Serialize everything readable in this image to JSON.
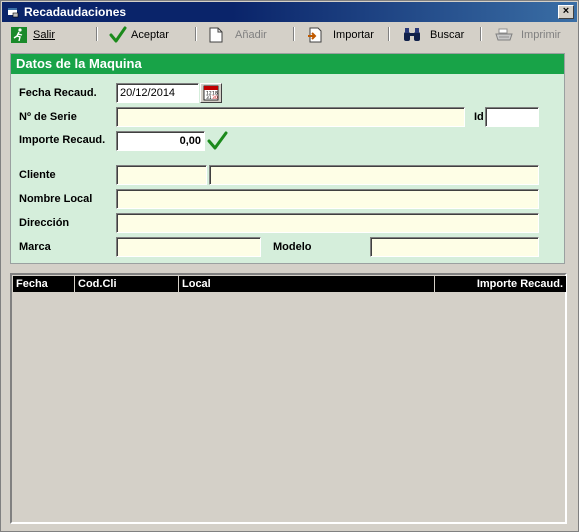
{
  "window": {
    "title": "Recadaudaciones",
    "close_label": "×"
  },
  "toolbar": {
    "salir": "Salir",
    "aceptar": "Aceptar",
    "anadir": "Añadir",
    "importar": "Importar",
    "buscar": "Buscar",
    "imprimir": "Imprimir"
  },
  "form": {
    "title": "Datos de la Maquina",
    "fecha_label": "Fecha Recaud.",
    "fecha_value": "20/12/2014",
    "serie_label": "Nº de Serie",
    "serie_value": "",
    "id_label": "Id",
    "id_value": "",
    "importe_label": "Importe Recaud.",
    "importe_value": "0,00",
    "cliente_label": "Cliente",
    "cliente_code": "",
    "cliente_name": "",
    "nombre_local_label": "Nombre Local",
    "nombre_local_value": "",
    "direccion_label": "Dirección",
    "direccion_value": "",
    "marca_label": "Marca",
    "marca_value": "",
    "modelo_label": "Modelo",
    "modelo_value": ""
  },
  "grid": {
    "columns": [
      "Fecha",
      "Cod.Cli",
      "Local",
      "Importe Recaud."
    ]
  },
  "colors": {
    "header_green": "#18a348",
    "panel_green": "#d5eedb",
    "field_yellow": "#fefee6",
    "title_blue": "#0a246a"
  }
}
